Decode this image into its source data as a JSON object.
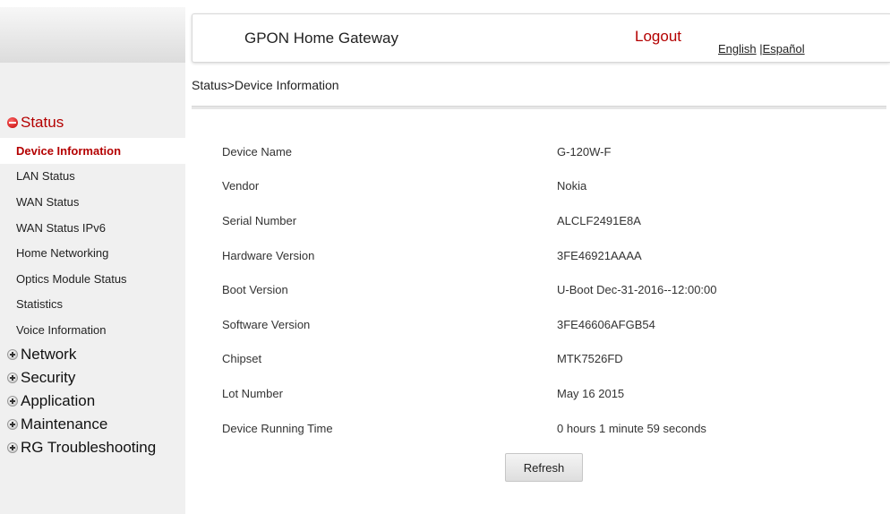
{
  "header": {
    "title": "GPON Home Gateway",
    "logout_label": "Logout",
    "lang_english": "English",
    "lang_separator": " |",
    "lang_spanish": "Español"
  },
  "breadcrumb": "Status>Device Information",
  "nav": {
    "status_label": "Status",
    "status_items": [
      "Device Information",
      "LAN Status",
      "WAN Status",
      "WAN Status IPv6",
      "Home Networking",
      "Optics Module Status",
      "Statistics",
      "Voice Information"
    ],
    "collapsed_groups": [
      "Network",
      "Security",
      "Application",
      "Maintenance",
      "RG Troubleshooting"
    ]
  },
  "device_info": [
    {
      "label": "Device Name",
      "value": "G-120W-F"
    },
    {
      "label": "Vendor",
      "value": "Nokia"
    },
    {
      "label": "Serial Number",
      "value": "ALCLF2491E8A"
    },
    {
      "label": "Hardware Version",
      "value": "3FE46921AAAA"
    },
    {
      "label": "Boot Version",
      "value": "U-Boot Dec-31-2016--12:00:00"
    },
    {
      "label": "Software Version",
      "value": "3FE46606AFGB54"
    },
    {
      "label": "Chipset",
      "value": "MTK7526FD"
    },
    {
      "label": "Lot Number",
      "value": "May 16 2015"
    },
    {
      "label": "Device Running Time",
      "value": "0 hours 1 minute 59 seconds"
    }
  ],
  "refresh_label": "Refresh",
  "colors": {
    "accent": "#b40000",
    "sidebar_bg": "#f0f0f0"
  }
}
